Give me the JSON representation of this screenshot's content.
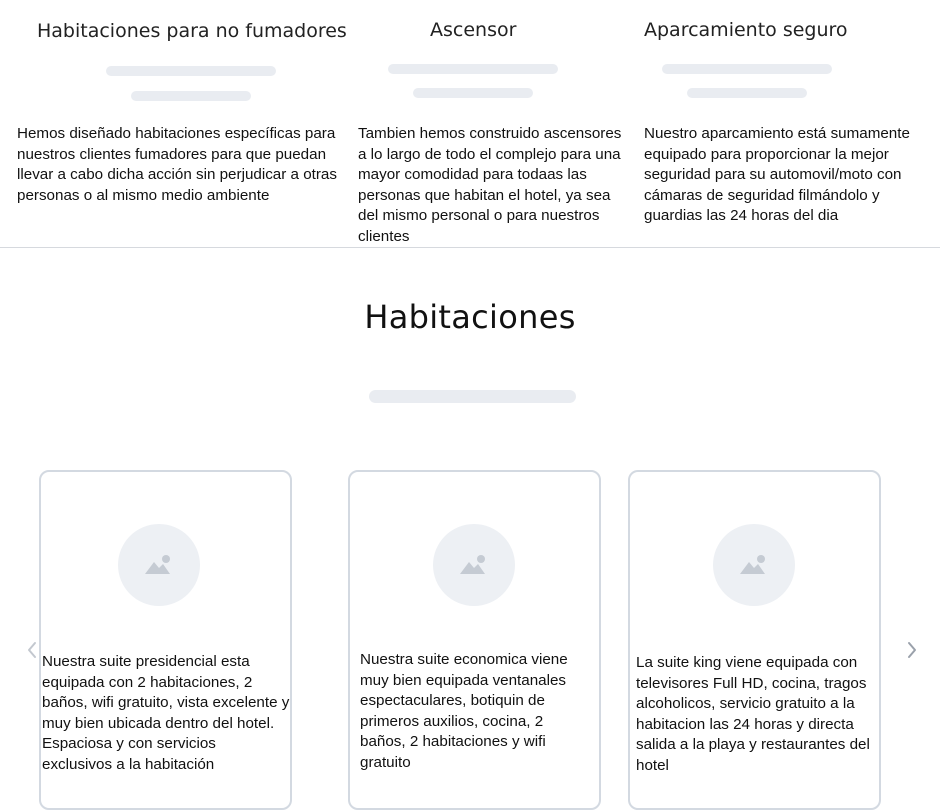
{
  "features": [
    {
      "title": "Habitaciones para no fumadores",
      "text": "Hemos diseñado habitaciones específicas para nuestros  clientes fumadores para que puedan llevar a cabo dicha acción sin perjudicar a otras personas o al mismo medio ambiente"
    },
    {
      "title": "Ascensor",
      "text": "Tambien hemos construido ascensores a lo largo de todo el complejo para una mayor comodidad para todaas las personas que habitan el hotel, ya sea del mismo personal o para nuestros clientes"
    },
    {
      "title": "Aparcamiento seguro",
      "text": "Nuestro aparcamiento está sumamente equipado para proporcionar la mejor seguridad para su automovil/moto con cámaras de seguridad filmándolo y  guardias las 24 horas del dia"
    }
  ],
  "rooms_section": {
    "title": "Habitaciones"
  },
  "rooms": [
    {
      "image_icon": "image-placeholder-icon",
      "text": "Nuestra suite presidencial esta equipada con 2 habitaciones, 2 baños, wifi gratuito, vista excelente y muy bien ubicada dentro del hotel. Espaciosa y con servicios exclusivos a la habitación"
    },
    {
      "image_icon": "image-placeholder-icon",
      "text": "Nuestra suite economica viene muy bien equipada ventanales espectaculares, botiquin de primeros auxilios, cocina, 2 baños, 2 habitaciones y wifi gratuito"
    },
    {
      "image_icon": "image-placeholder-icon",
      "text": "La suite king viene equipada con televisores Full HD, cocina, tragos alcoholicos, servicio gratuito a la habitacion las 24 horas y directa salida a la playa y restaurantes del hotel"
    }
  ],
  "carousel": {
    "prev_icon": "chevron-left-icon",
    "next_icon": "chevron-right-icon"
  },
  "colors": {
    "placeholder": "#e9ecf1",
    "card_border": "#d3d9e1",
    "divider": "#d6d9de"
  }
}
